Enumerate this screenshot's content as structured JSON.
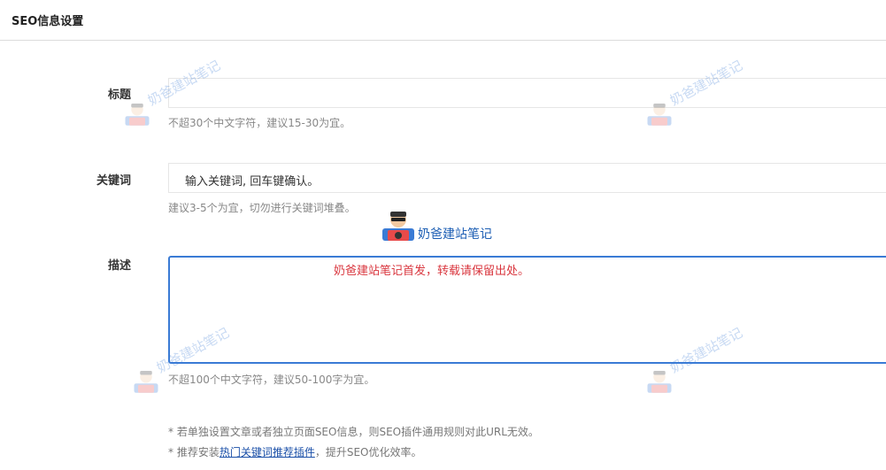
{
  "header": {
    "title": "SEO信息设置"
  },
  "fields": {
    "title": {
      "label": "标题",
      "value": "",
      "hint": "不超30个中文字符，建议15-30为宜。"
    },
    "keywords": {
      "label": "关键词",
      "value": "输入关键词, 回车键确认。",
      "hint": "建议3-5个为宜，切勿进行关键词堆叠。"
    },
    "description": {
      "label": "描述",
      "value": "奶爸建站笔记首发，转载请保留出处。",
      "hint": "不超100个中文字符，建议50-100字为宜。"
    }
  },
  "notes": {
    "line1": "* 若单独设置文章或者独立页面SEO信息，则SEO插件通用规则对此URL无效。",
    "line2_prefix": "* 推荐安装",
    "line2_link": "热门关键词推荐插件",
    "line2_suffix": "，提升SEO优化效率。"
  },
  "watermark": {
    "text": "奶爸建站笔记"
  },
  "brand": {
    "text": "奶爸建站笔记"
  },
  "colors": {
    "accent": "#3a7bd5",
    "description_text": "#d9363e",
    "link": "#1a4fa8"
  }
}
